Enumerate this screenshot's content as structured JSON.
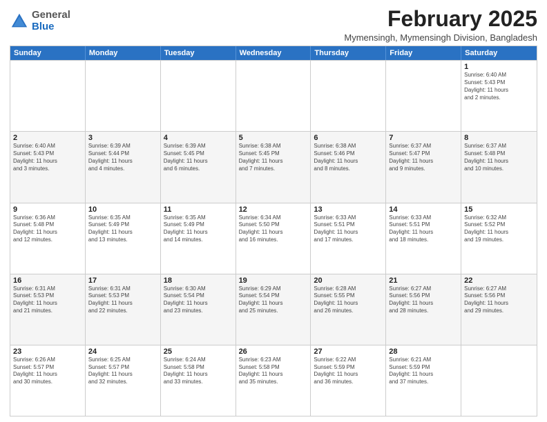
{
  "header": {
    "logo": {
      "general": "General",
      "blue": "Blue"
    },
    "title": "February 2025",
    "subtitle": "Mymensingh, Mymensingh Division, Bangladesh"
  },
  "calendar": {
    "days": [
      "Sunday",
      "Monday",
      "Tuesday",
      "Wednesday",
      "Thursday",
      "Friday",
      "Saturday"
    ],
    "rows": [
      [
        {
          "day": "",
          "info": ""
        },
        {
          "day": "",
          "info": ""
        },
        {
          "day": "",
          "info": ""
        },
        {
          "day": "",
          "info": ""
        },
        {
          "day": "",
          "info": ""
        },
        {
          "day": "",
          "info": ""
        },
        {
          "day": "1",
          "info": "Sunrise: 6:40 AM\nSunset: 5:43 PM\nDaylight: 11 hours\nand 2 minutes."
        }
      ],
      [
        {
          "day": "2",
          "info": "Sunrise: 6:40 AM\nSunset: 5:43 PM\nDaylight: 11 hours\nand 3 minutes."
        },
        {
          "day": "3",
          "info": "Sunrise: 6:39 AM\nSunset: 5:44 PM\nDaylight: 11 hours\nand 4 minutes."
        },
        {
          "day": "4",
          "info": "Sunrise: 6:39 AM\nSunset: 5:45 PM\nDaylight: 11 hours\nand 6 minutes."
        },
        {
          "day": "5",
          "info": "Sunrise: 6:38 AM\nSunset: 5:45 PM\nDaylight: 11 hours\nand 7 minutes."
        },
        {
          "day": "6",
          "info": "Sunrise: 6:38 AM\nSunset: 5:46 PM\nDaylight: 11 hours\nand 8 minutes."
        },
        {
          "day": "7",
          "info": "Sunrise: 6:37 AM\nSunset: 5:47 PM\nDaylight: 11 hours\nand 9 minutes."
        },
        {
          "day": "8",
          "info": "Sunrise: 6:37 AM\nSunset: 5:48 PM\nDaylight: 11 hours\nand 10 minutes."
        }
      ],
      [
        {
          "day": "9",
          "info": "Sunrise: 6:36 AM\nSunset: 5:48 PM\nDaylight: 11 hours\nand 12 minutes."
        },
        {
          "day": "10",
          "info": "Sunrise: 6:35 AM\nSunset: 5:49 PM\nDaylight: 11 hours\nand 13 minutes."
        },
        {
          "day": "11",
          "info": "Sunrise: 6:35 AM\nSunset: 5:49 PM\nDaylight: 11 hours\nand 14 minutes."
        },
        {
          "day": "12",
          "info": "Sunrise: 6:34 AM\nSunset: 5:50 PM\nDaylight: 11 hours\nand 16 minutes."
        },
        {
          "day": "13",
          "info": "Sunrise: 6:33 AM\nSunset: 5:51 PM\nDaylight: 11 hours\nand 17 minutes."
        },
        {
          "day": "14",
          "info": "Sunrise: 6:33 AM\nSunset: 5:51 PM\nDaylight: 11 hours\nand 18 minutes."
        },
        {
          "day": "15",
          "info": "Sunrise: 6:32 AM\nSunset: 5:52 PM\nDaylight: 11 hours\nand 19 minutes."
        }
      ],
      [
        {
          "day": "16",
          "info": "Sunrise: 6:31 AM\nSunset: 5:53 PM\nDaylight: 11 hours\nand 21 minutes."
        },
        {
          "day": "17",
          "info": "Sunrise: 6:31 AM\nSunset: 5:53 PM\nDaylight: 11 hours\nand 22 minutes."
        },
        {
          "day": "18",
          "info": "Sunrise: 6:30 AM\nSunset: 5:54 PM\nDaylight: 11 hours\nand 23 minutes."
        },
        {
          "day": "19",
          "info": "Sunrise: 6:29 AM\nSunset: 5:54 PM\nDaylight: 11 hours\nand 25 minutes."
        },
        {
          "day": "20",
          "info": "Sunrise: 6:28 AM\nSunset: 5:55 PM\nDaylight: 11 hours\nand 26 minutes."
        },
        {
          "day": "21",
          "info": "Sunrise: 6:27 AM\nSunset: 5:56 PM\nDaylight: 11 hours\nand 28 minutes."
        },
        {
          "day": "22",
          "info": "Sunrise: 6:27 AM\nSunset: 5:56 PM\nDaylight: 11 hours\nand 29 minutes."
        }
      ],
      [
        {
          "day": "23",
          "info": "Sunrise: 6:26 AM\nSunset: 5:57 PM\nDaylight: 11 hours\nand 30 minutes."
        },
        {
          "day": "24",
          "info": "Sunrise: 6:25 AM\nSunset: 5:57 PM\nDaylight: 11 hours\nand 32 minutes."
        },
        {
          "day": "25",
          "info": "Sunrise: 6:24 AM\nSunset: 5:58 PM\nDaylight: 11 hours\nand 33 minutes."
        },
        {
          "day": "26",
          "info": "Sunrise: 6:23 AM\nSunset: 5:58 PM\nDaylight: 11 hours\nand 35 minutes."
        },
        {
          "day": "27",
          "info": "Sunrise: 6:22 AM\nSunset: 5:59 PM\nDaylight: 11 hours\nand 36 minutes."
        },
        {
          "day": "28",
          "info": "Sunrise: 6:21 AM\nSunset: 5:59 PM\nDaylight: 11 hours\nand 37 minutes."
        },
        {
          "day": "",
          "info": ""
        }
      ]
    ]
  }
}
